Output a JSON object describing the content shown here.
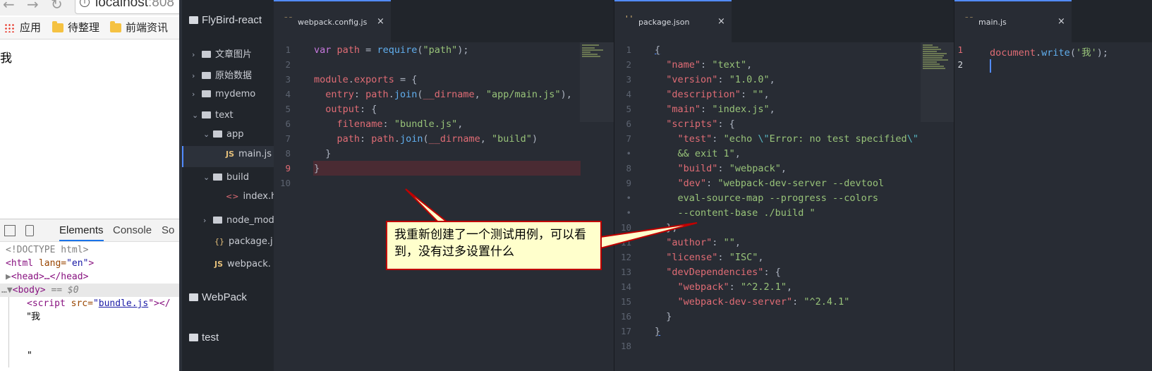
{
  "browser": {
    "address_host": "localhost",
    "address_port": ":808",
    "bookmarks": [
      "应用",
      "待整理",
      "前端资讯"
    ],
    "page_text": "我",
    "devtools": {
      "tabs": [
        "Elements",
        "Console",
        "So"
      ],
      "lines": {
        "doctype": "<!DOCTYPE html>",
        "html_open_tag": "<html",
        "html_attr": " lang=",
        "html_attr_val": "\"en\"",
        "html_close": ">",
        "head": "<head>…</head>",
        "body_open": "<body>",
        "body_eq": " == $0",
        "script_open": "<script",
        "script_attr": " src=",
        "script_src": "bundle.js",
        "script_tail": "\"></",
        "text_node": "\"我",
        "text_close": "\""
      }
    }
  },
  "editor": {
    "projects": [
      "FlyBird-react",
      "WebPack",
      "test"
    ],
    "tree": [
      {
        "label": "文章图片",
        "kind": "folder",
        "chev": "›"
      },
      {
        "label": "原始数据",
        "kind": "folder",
        "chev": "›"
      },
      {
        "label": "mydemo",
        "kind": "folder",
        "chev": "›"
      },
      {
        "label": "text",
        "kind": "folder",
        "chev": "⌄"
      },
      {
        "label": "app",
        "kind": "folder",
        "chev": "⌄"
      },
      {
        "label": "main.js",
        "kind": "js",
        "icon": "JS"
      },
      {
        "label": "build",
        "kind": "folder",
        "chev": "⌄"
      },
      {
        "label": "index.h",
        "kind": "html",
        "icon": "<>"
      },
      {
        "label": "node_mod",
        "kind": "folder",
        "chev": "›"
      },
      {
        "label": "package.j",
        "kind": "json",
        "icon": "{}"
      },
      {
        "label": "webpack.",
        "kind": "js",
        "icon": "JS"
      }
    ],
    "tabs": {
      "webpack": "webpack.config.js",
      "package": "package.json",
      "main": "main.js",
      "close": "×",
      "icon": "⁻⁻",
      "json_icon": "''"
    },
    "webpack_lines": [
      "1",
      "2",
      "3",
      "4",
      "5",
      "6",
      "7",
      "8",
      "9",
      "10"
    ],
    "package_lines": [
      "1",
      "2",
      "3",
      "4",
      "5",
      "6",
      "7",
      "•",
      "8",
      "9",
      "•",
      "•",
      "10",
      "11",
      "12",
      "13",
      "14",
      "15",
      "16",
      "17",
      "18"
    ],
    "main_lines": [
      "1",
      "2"
    ],
    "callout_text": "我重新创建了一个测试用例，可以看到，没有过多设置什么"
  }
}
